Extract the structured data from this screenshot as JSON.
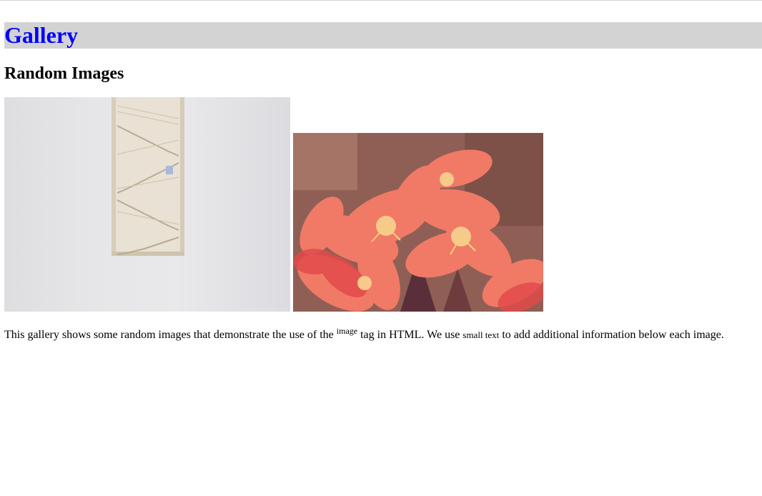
{
  "header": {
    "title": "Gallery"
  },
  "section": {
    "title": "Random Images"
  },
  "images": [
    {
      "name": "stairwell-photo",
      "subject": "white stairwell seen through a narrow window"
    },
    {
      "name": "flowers-photo",
      "subject": "coral orange lily flowers"
    }
  ],
  "caption": {
    "part1": "This gallery shows some random images that demonstrate the use of the ",
    "sup": "image",
    "part2": " tag in HTML. We use ",
    "small": "small text",
    "part3": " to add additional information below each image."
  },
  "colors": {
    "header_bg": "#d3d3d3",
    "title": "#0000ff"
  }
}
